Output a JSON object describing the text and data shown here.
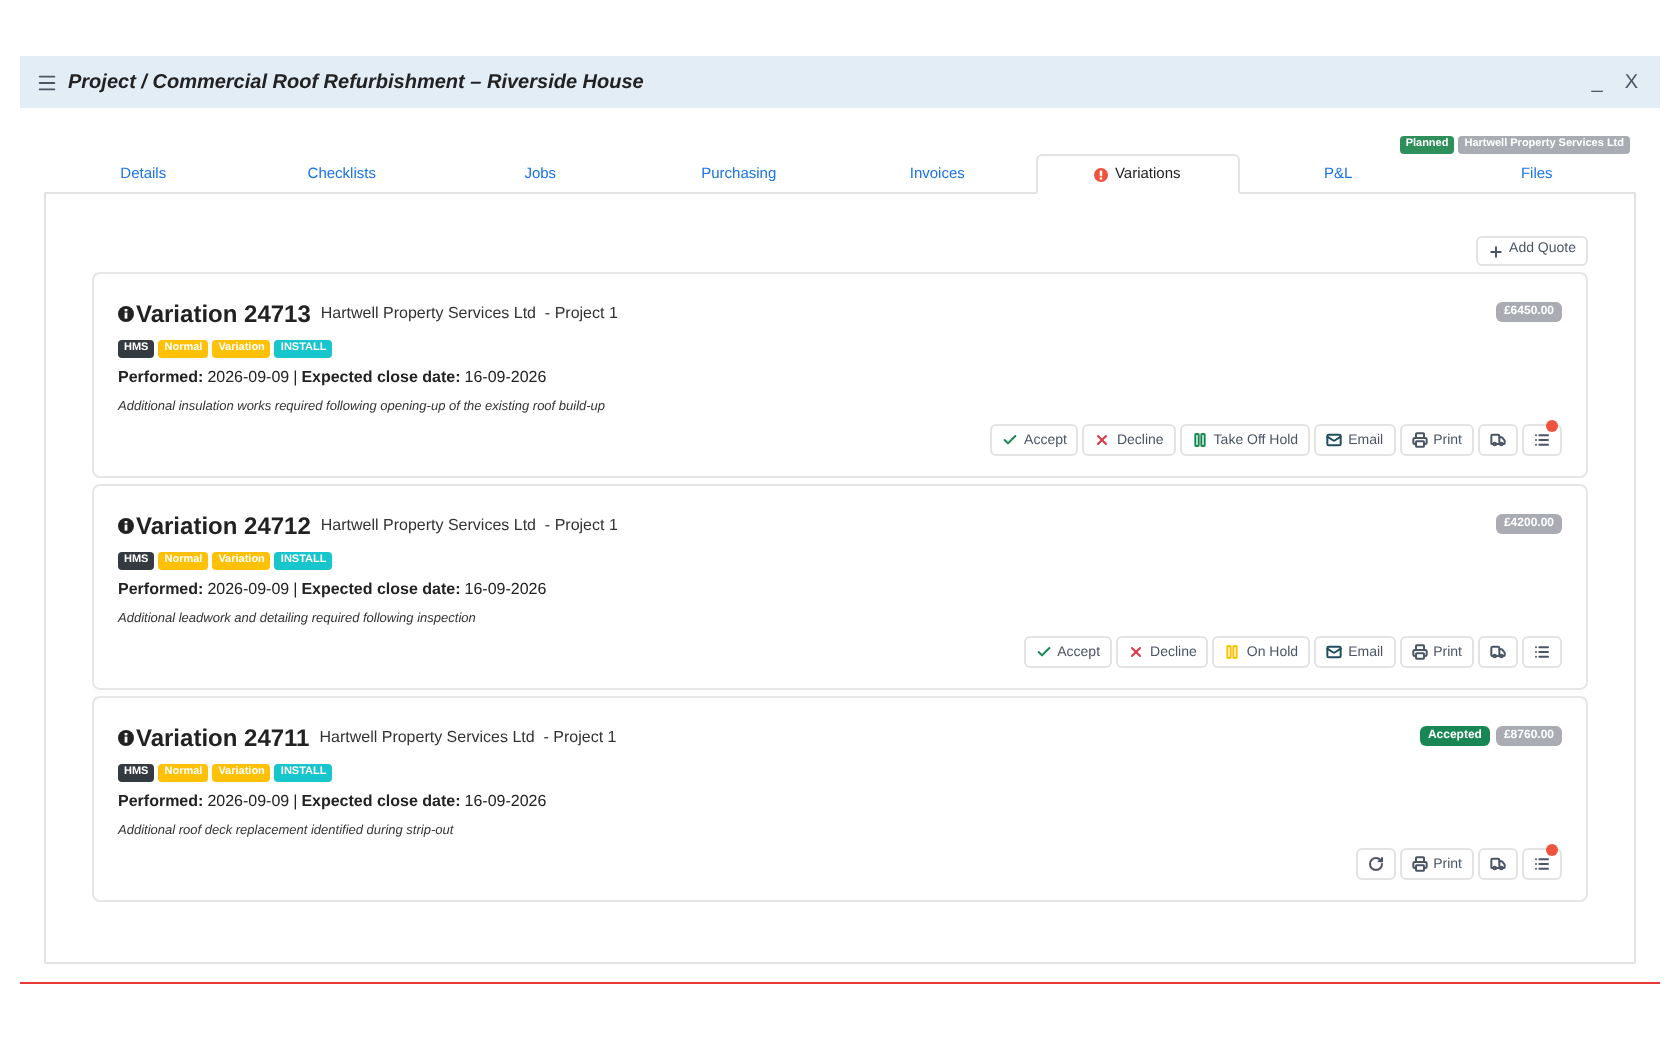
{
  "window": {
    "title": "Project / Commercial Roof Refurbishment – Riverside House",
    "minimize": "_",
    "close": "X"
  },
  "status_badges": [
    {
      "label": "Planned",
      "color": "#2f8f5b"
    },
    {
      "label": "Hartwell Property Services Ltd",
      "color": "#a9adb3"
    }
  ],
  "tabs": [
    {
      "label": "Details",
      "selected": false,
      "alert": false
    },
    {
      "label": "Checklists",
      "selected": false,
      "alert": false
    },
    {
      "label": "Jobs",
      "selected": false,
      "alert": false
    },
    {
      "label": "Purchasing",
      "selected": false,
      "alert": false
    },
    {
      "label": "Invoices",
      "selected": false,
      "alert": false
    },
    {
      "label": "Variations",
      "selected": true,
      "alert": true
    },
    {
      "label": "P&L",
      "selected": false,
      "alert": false
    },
    {
      "label": "Files",
      "selected": false,
      "alert": false
    }
  ],
  "add_quote": "Add Quote",
  "variations": [
    {
      "title": "Variation 24713",
      "client": "Hartwell Property Services Ltd  - Project 1",
      "tags": [
        {
          "label": "HMS",
          "color": "#343a40"
        },
        {
          "label": "Normal",
          "color": "#ffc107"
        },
        {
          "label": "Variation",
          "color": "#ffc107"
        },
        {
          "label": "INSTALL",
          "color": "#17c5cc"
        }
      ],
      "performed_label": "Performed:",
      "performed": "2026-09-09",
      "separator": "|",
      "close_label": "Expected close date:",
      "close_date": "16-09-2026",
      "description": "Additional insulation works required following opening-up of the existing roof build-up",
      "amount": "£6450.00",
      "actions": [
        {
          "kind": "accept",
          "label": "Accept",
          "notification": false
        },
        {
          "kind": "decline",
          "label": "Decline",
          "notification": false
        },
        {
          "kind": "take-off-hold",
          "label": "Take Off Hold",
          "notification": false
        },
        {
          "kind": "email",
          "label": "Email",
          "notification": false
        },
        {
          "kind": "print",
          "label": "Print",
          "notification": false
        },
        {
          "kind": "truck",
          "notification": false
        },
        {
          "kind": "list",
          "notification": true
        }
      ]
    },
    {
      "title": "Variation 24712",
      "client": "Hartwell Property Services Ltd  - Project 1",
      "tags": [
        {
          "label": "HMS",
          "color": "#343a40"
        },
        {
          "label": "Normal",
          "color": "#ffc107"
        },
        {
          "label": "Variation",
          "color": "#ffc107"
        },
        {
          "label": "INSTALL",
          "color": "#17c5cc"
        }
      ],
      "performed_label": "Performed:",
      "performed": "2026-09-09",
      "separator": "|",
      "close_label": "Expected close date:",
      "close_date": "16-09-2026",
      "description": "Additional leadwork and detailing required following inspection",
      "amount": "£4200.00",
      "actions": [
        {
          "kind": "accept",
          "label": "Accept",
          "notification": false
        },
        {
          "kind": "decline",
          "label": "Decline",
          "notification": false
        },
        {
          "kind": "on-hold",
          "label": "On Hold",
          "notification": false
        },
        {
          "kind": "email",
          "label": "Email",
          "notification": false
        },
        {
          "kind": "print",
          "label": "Print",
          "notification": false
        },
        {
          "kind": "truck",
          "notification": false
        },
        {
          "kind": "list",
          "notification": false
        }
      ]
    },
    {
      "title": "Variation 24711",
      "client": "Hartwell Property Services Ltd  - Project 1",
      "tags": [
        {
          "label": "HMS",
          "color": "#343a40"
        },
        {
          "label": "Normal",
          "color": "#ffc107"
        },
        {
          "label": "Variation",
          "color": "#ffc107"
        },
        {
          "label": "INSTALL",
          "color": "#17c5cc"
        }
      ],
      "performed_label": "Performed:",
      "performed": "2026-09-09",
      "separator": "|",
      "close_label": "Expected close date:",
      "close_date": "16-09-2026",
      "description": "Additional roof deck replacement identified during strip-out",
      "status": "Accepted",
      "amount": "£8760.00",
      "actions": [
        {
          "kind": "reopen",
          "notification": false
        },
        {
          "kind": "print",
          "label": "Print",
          "notification": false
        },
        {
          "kind": "truck",
          "notification": false
        },
        {
          "kind": "list",
          "notification": true
        }
      ]
    }
  ]
}
